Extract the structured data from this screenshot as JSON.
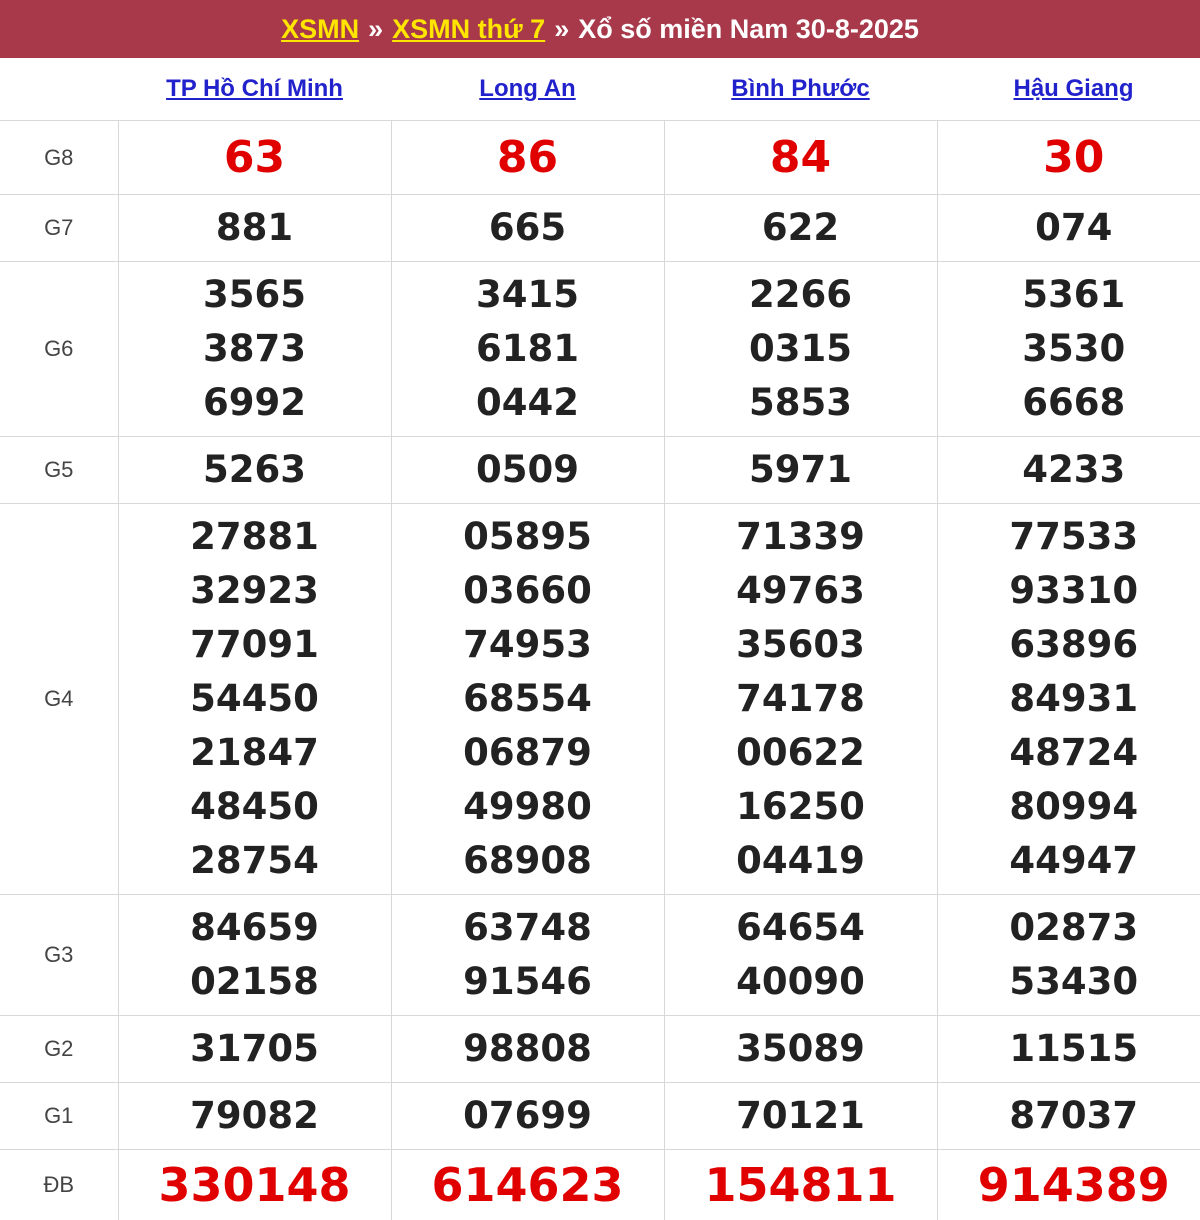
{
  "header": {
    "link1": "XSMN",
    "sep1": "»",
    "link2": "XSMN thứ 7",
    "sep2": "»",
    "title": "Xổ số miền Nam 30-8-2025"
  },
  "colors": {
    "header_bg": "#a8394a",
    "link_yellow": "#ffe600",
    "province_link": "#2222cc",
    "special_red": "#e00000"
  },
  "provinces": [
    "TP Hồ Chí Minh",
    "Long An",
    "Bình Phước",
    "Hậu Giang"
  ],
  "prizes": [
    {
      "label": "G8",
      "values": [
        [
          "63"
        ],
        [
          "86"
        ],
        [
          "84"
        ],
        [
          "30"
        ]
      ]
    },
    {
      "label": "G7",
      "values": [
        [
          "881"
        ],
        [
          "665"
        ],
        [
          "622"
        ],
        [
          "074"
        ]
      ]
    },
    {
      "label": "G6",
      "values": [
        [
          "3565",
          "3873",
          "6992"
        ],
        [
          "3415",
          "6181",
          "0442"
        ],
        [
          "2266",
          "0315",
          "5853"
        ],
        [
          "5361",
          "3530",
          "6668"
        ]
      ]
    },
    {
      "label": "G5",
      "values": [
        [
          "5263"
        ],
        [
          "0509"
        ],
        [
          "5971"
        ],
        [
          "4233"
        ]
      ]
    },
    {
      "label": "G4",
      "values": [
        [
          "27881",
          "32923",
          "77091",
          "54450",
          "21847",
          "48450",
          "28754"
        ],
        [
          "05895",
          "03660",
          "74953",
          "68554",
          "06879",
          "49980",
          "68908"
        ],
        [
          "71339",
          "49763",
          "35603",
          "74178",
          "00622",
          "16250",
          "04419"
        ],
        [
          "77533",
          "93310",
          "63896",
          "84931",
          "48724",
          "80994",
          "44947"
        ]
      ]
    },
    {
      "label": "G3",
      "values": [
        [
          "84659",
          "02158"
        ],
        [
          "63748",
          "91546"
        ],
        [
          "64654",
          "40090"
        ],
        [
          "02873",
          "53430"
        ]
      ]
    },
    {
      "label": "G2",
      "values": [
        [
          "31705"
        ],
        [
          "98808"
        ],
        [
          "35089"
        ],
        [
          "11515"
        ]
      ]
    },
    {
      "label": "G1",
      "values": [
        [
          "79082"
        ],
        [
          "07699"
        ],
        [
          "70121"
        ],
        [
          "87037"
        ]
      ]
    },
    {
      "label": "ĐB",
      "values": [
        [
          "330148"
        ],
        [
          "614623"
        ],
        [
          "154811"
        ],
        [
          "914389"
        ]
      ]
    }
  ]
}
